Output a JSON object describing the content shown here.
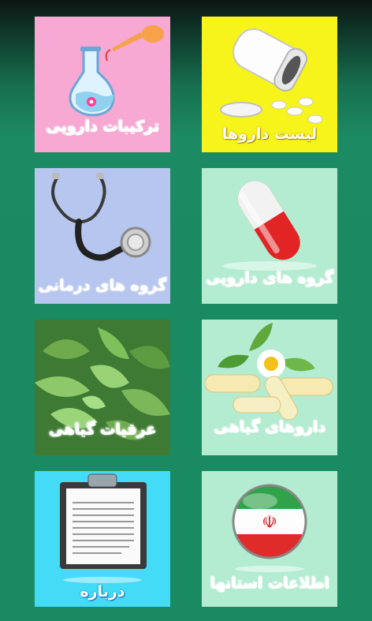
{
  "tiles": [
    {
      "id": "formulations",
      "label": "ترکیبات دارویی",
      "icon": "flask-icon"
    },
    {
      "id": "drug-list",
      "label": "لیست داروها",
      "icon": "pill-bottle-icon"
    },
    {
      "id": "therapeutic-groups",
      "label": "گروه های درمانی",
      "icon": "stethoscope-icon"
    },
    {
      "id": "drug-groups",
      "label": "گروه های دارویی",
      "icon": "capsule-icon"
    },
    {
      "id": "herbal-extracts",
      "label": "عرقیات گیاهی",
      "icon": "mint-leaves-icon"
    },
    {
      "id": "herbal-drugs",
      "label": "داروهای گیاهی",
      "icon": "herbal-capsules-icon"
    },
    {
      "id": "about",
      "label": "درباره",
      "icon": "clipboard-icon"
    },
    {
      "id": "province-info",
      "label": "اطلاعات استانها",
      "icon": "iran-flag-icon"
    }
  ],
  "colors": {
    "tile_pink": "#f7a8d3",
    "tile_yellow": "#f6f41a",
    "tile_lavender": "#b6c6ee",
    "tile_mint": "#b4ecd2",
    "tile_cyan": "#43dbf6",
    "background": "#1a8a62"
  }
}
